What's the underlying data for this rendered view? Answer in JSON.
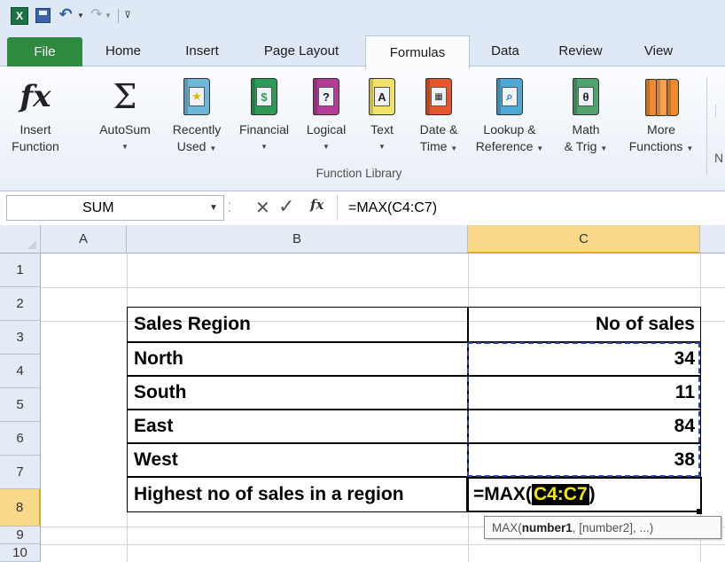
{
  "quick_access": {
    "logo_letter": "X"
  },
  "tabs": [
    {
      "label": "File"
    },
    {
      "label": "Home"
    },
    {
      "label": "Insert"
    },
    {
      "label": "Page Layout"
    },
    {
      "label": "Formulas"
    },
    {
      "label": "Data"
    },
    {
      "label": "Review"
    },
    {
      "label": "View"
    }
  ],
  "ribbon": {
    "group_label": "Function Library",
    "next_group_partial": "N",
    "buttons": [
      {
        "line1": "Insert",
        "line2": "Function",
        "icon": "fx-icon"
      },
      {
        "line1": "AutoSum",
        "line2": "",
        "icon": "sigma-icon",
        "dropdown": true
      },
      {
        "line1": "Recently",
        "line2": "Used",
        "icon": "star-book-icon",
        "dropdown": true
      },
      {
        "line1": "Financial",
        "line2": "",
        "icon": "financial-book-icon",
        "dropdown": true
      },
      {
        "line1": "Logical",
        "line2": "",
        "icon": "question-book-icon",
        "dropdown": true
      },
      {
        "line1": "Text",
        "line2": "",
        "icon": "text-book-icon",
        "dropdown": true
      },
      {
        "line1": "Date &",
        "line2": "Time",
        "icon": "calendar-book-icon",
        "dropdown": true
      },
      {
        "line1": "Lookup &",
        "line2": "Reference",
        "icon": "magnifier-book-icon",
        "dropdown": true
      },
      {
        "line1": "Math",
        "line2": "& Trig",
        "icon": "theta-book-icon",
        "dropdown": true
      },
      {
        "line1": "More",
        "line2": "Functions",
        "icon": "books-icon",
        "dropdown": true
      }
    ],
    "icon_glyphs": {
      "question": "?",
      "text": "A",
      "theta": "θ",
      "sigma": "Σ",
      "fx": "fx"
    },
    "colors": {
      "star_book": "#6fb7d9",
      "financial_book": "#2f9a57",
      "question_book": "#b23c97",
      "text_book": "#f2e26b",
      "calendar_book": "#e4562c",
      "magnifier_book": "#4ea9d5",
      "theta_book": "#4fa36b",
      "more_books": "#f18a2c"
    }
  },
  "formula_bar": {
    "name_box": "SUM",
    "formula": "=MAX(C4:C7)"
  },
  "sheet": {
    "columns": [
      "A",
      "B",
      "C"
    ],
    "rows": [
      "1",
      "2",
      "3",
      "4",
      "5",
      "6",
      "7",
      "8",
      "9",
      "10"
    ],
    "header": {
      "region": "Sales Region",
      "sales": "No of sales"
    },
    "data": [
      {
        "region": "North",
        "sales": "34"
      },
      {
        "region": "South",
        "sales": "11"
      },
      {
        "region": "East",
        "sales": "84"
      },
      {
        "region": "West",
        "sales": "38"
      }
    ],
    "summary_label": "Highest no of sales in a region",
    "editing": {
      "prefix": "=MAX(",
      "ref": "C4:C7",
      "suffix": ")"
    },
    "tooltip": {
      "fn": "MAX(",
      "arg1": "number1",
      "rest": ", [number2], ...)"
    },
    "selection_color": "#f8d98a",
    "reference_color": "#2b4aa8"
  }
}
